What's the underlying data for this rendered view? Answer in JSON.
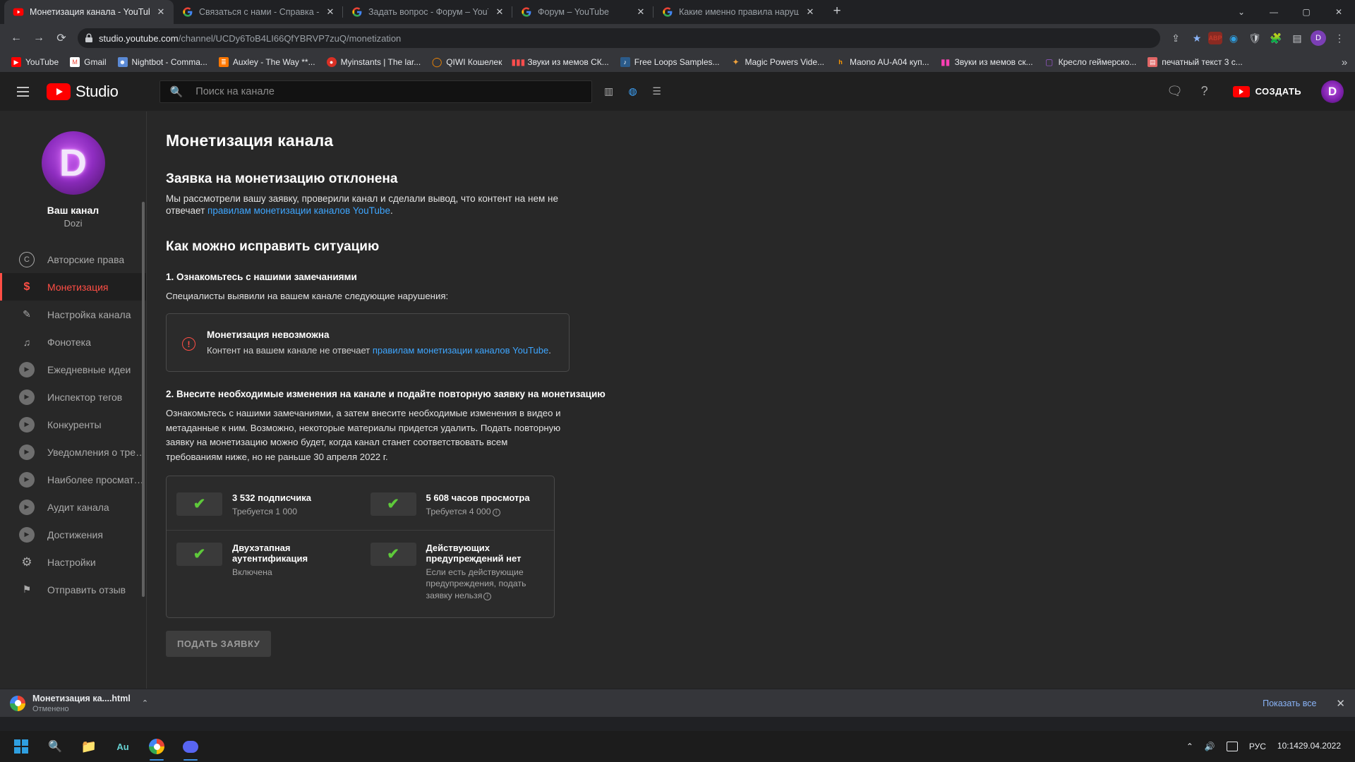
{
  "browser": {
    "tabs": [
      {
        "title": "Монетизация канала - YouTube",
        "favicon": "youtube-icon",
        "active": true
      },
      {
        "title": "Связаться с нами - Справка - Yo",
        "favicon": "google-icon",
        "active": false
      },
      {
        "title": "Задать вопрос - Форум – YouTu",
        "favicon": "google-icon",
        "active": false
      },
      {
        "title": "Форум – YouTube",
        "favicon": "google-icon",
        "active": false
      },
      {
        "title": "Какие именно правила нарушае",
        "favicon": "google-icon",
        "active": false
      }
    ],
    "new_tab_label": "+",
    "window_controls": {
      "minimize": "—",
      "maximize": "▢",
      "close": "✕",
      "extra": "⌄"
    },
    "nav": {
      "back": "←",
      "forward": "→",
      "reload": "⟳"
    },
    "address": {
      "lock_icon": "lock-icon",
      "domain": "studio.youtube.com",
      "path": "/channel/UCDy6ToB4LI66QfYBRVP7zuQ/monetization"
    },
    "toolbar_icons": [
      "share-icon",
      "bookmark-star-icon",
      "extension-abp-icon",
      "extension-blue-icon",
      "extension-shield-icon",
      "extension-puzzle-icon",
      "sidepanel-icon"
    ],
    "profile_initial": "D",
    "menu_icon": "kebab-menu-icon",
    "bookmarks": [
      {
        "label": "YouTube",
        "icon": "youtube-icon",
        "color": "#ff0000"
      },
      {
        "label": "Gmail",
        "icon": "gmail-icon",
        "color": "#ea4335"
      },
      {
        "label": "Nightbot - Comma...",
        "icon": "nightbot-icon",
        "color": "#5b8ad6"
      },
      {
        "label": "Auxley - The Way **...",
        "icon": "soundcloud-icon",
        "color": "#ff7700"
      },
      {
        "label": "Myinstants | The lar...",
        "icon": "myinstants-icon",
        "color": "#d93025"
      },
      {
        "label": "QIWI Кошелек",
        "icon": "qiwi-icon",
        "color": "#ff8c00"
      },
      {
        "label": "Звуки из мемов СК...",
        "icon": "equalizer-icon",
        "color": "#ff4d4d"
      },
      {
        "label": "Free Loops Samples...",
        "icon": "loops-icon",
        "color": "#8ab4f8"
      },
      {
        "label": "Magic Powers Vide...",
        "icon": "magic-icon",
        "color": "#f2a33c"
      },
      {
        "label": "Maono AU-A04 куп...",
        "icon": "shop-icon",
        "color": "#ff9900"
      },
      {
        "label": "Звуки из мемов ск...",
        "icon": "pink-bars-icon",
        "color": "#ff3fb5"
      },
      {
        "label": "Кресло геймерско...",
        "icon": "chair-icon",
        "color": "#9b59d0"
      },
      {
        "label": "печатный текст 3 с...",
        "icon": "doc-icon",
        "color": "#e06666"
      }
    ],
    "bookmarks_overflow": "»"
  },
  "studio": {
    "header": {
      "menu_icon": "hamburger-icon",
      "logo_text": "Studio",
      "search_placeholder": "Поиск на канале",
      "search_value": "",
      "search_icon": "search-icon",
      "adjust_icons": [
        "slider-icon",
        "translate-icon",
        "list-icon"
      ],
      "feedback_icon": "feedback-icon",
      "help_icon": "help-icon",
      "create_label": "СОЗДАТЬ",
      "create_icon": "video-camera-icon",
      "avatar_initial": "D"
    },
    "sidebar": {
      "channel_avatar_letter": "D",
      "channel_title": "Ваш канал",
      "channel_name": "Dozi",
      "items": [
        {
          "label": "Авторские права",
          "icon": "copyright-icon",
          "active": false
        },
        {
          "label": "Монетизация",
          "icon": "dollar-icon",
          "active": true
        },
        {
          "label": "Настройка канала",
          "icon": "magic-wand-icon",
          "active": false
        },
        {
          "label": "Фонотека",
          "icon": "music-library-icon",
          "active": false
        },
        {
          "label": "Ежедневные идеи",
          "icon": "vidiq-play-icon",
          "active": false
        },
        {
          "label": "Инспектор тегов",
          "icon": "vidiq-play-icon",
          "active": false
        },
        {
          "label": "Конкуренты",
          "icon": "vidiq-play-icon",
          "active": false
        },
        {
          "label": "Уведомления о тренд…",
          "icon": "vidiq-play-icon",
          "active": false
        },
        {
          "label": "Наиболее просматри…",
          "icon": "vidiq-play-icon",
          "active": false
        },
        {
          "label": "Аудит канала",
          "icon": "vidiq-play-icon",
          "active": false
        },
        {
          "label": "Достижения",
          "icon": "vidiq-play-icon",
          "active": false
        },
        {
          "label": "Настройки",
          "icon": "gear-icon",
          "active": false
        },
        {
          "label": "Отправить отзыв",
          "icon": "send-feedback-icon",
          "active": false
        }
      ]
    },
    "main": {
      "page_title": "Монетизация канала",
      "rejected_title": "Заявка на монетизацию отклонена",
      "rejected_text_prefix": "Мы рассмотрели вашу заявку, проверили канал и сделали вывод, что контент на нем не отвечает ",
      "rejected_link": "правилам монетизации каналов YouTube",
      "rejected_text_suffix": ".",
      "howto_title": "Как можно исправить ситуацию",
      "step1_title": "1. Ознакомьтесь с нашими замечаниями",
      "step1_desc": "Специалисты выявили на вашем канале следующие нарушения:",
      "alert": {
        "icon": "error-circle-icon",
        "heading": "Монетизация невозможна",
        "text_prefix": "Контент на вашем канале не отвечает ",
        "link": "правилам монетизации каналов YouTube",
        "text_suffix": "."
      },
      "step2_title": "2. Внесите необходимые изменения на канале и подайте повторную заявку на монетизацию",
      "step2_desc": "Ознакомьтесь с нашими замечаниями, а затем внесите необходимые изменения в видео и метаданные к ним. Возможно, некоторые материалы придется удалить. Подать повторную заявку на монетизацию можно будет, когда канал станет соответствовать всем требованиям ниже, но не раньше 30 апреля 2022 г.",
      "requirements": [
        {
          "check_icon": "check-icon",
          "title": "3 532 подписчика",
          "sub": "Требуется 1 000",
          "info": false
        },
        {
          "check_icon": "check-icon",
          "title": "5 608 часов просмотра",
          "sub": "Требуется 4 000",
          "info": true
        },
        {
          "check_icon": "check-icon",
          "title": "Двухэтапная аутентификация",
          "sub": "Включена",
          "info": false
        },
        {
          "check_icon": "check-icon",
          "title": "Действующих предупреждений нет",
          "sub": "Если есть действующие предупреждения, подать заявку нельзя",
          "info": true
        }
      ],
      "submit_label": "ПОДАТЬ ЗАЯВКУ"
    }
  },
  "download_bar": {
    "icon": "chrome-icon",
    "filename": "Монетизация ка....html",
    "status": "Отменено",
    "caret": "⌃",
    "show_all": "Показать все",
    "close": "✕"
  },
  "taskbar": {
    "start_icon": "windows-start-icon",
    "search_icon": "search-icon",
    "apps": [
      {
        "name": "file-explorer-icon",
        "label": "",
        "open": false
      },
      {
        "name": "audition-icon",
        "label": "Au",
        "open": false
      },
      {
        "name": "chrome-icon",
        "label": "",
        "open": true
      },
      {
        "name": "discord-icon",
        "label": "",
        "open": true
      }
    ],
    "tray": {
      "chevron": "⌃",
      "volume_icon": "volume-icon",
      "notification_icon": "notification-icon",
      "language": "РУС",
      "time": "10:14",
      "date": "29.04.2022"
    }
  },
  "colors": {
    "accent_red": "#ff4e45",
    "link_blue": "#3ea6ff",
    "check_green": "#5ec93a",
    "studio_bg": "#282828",
    "chrome_bg": "#35363a"
  }
}
